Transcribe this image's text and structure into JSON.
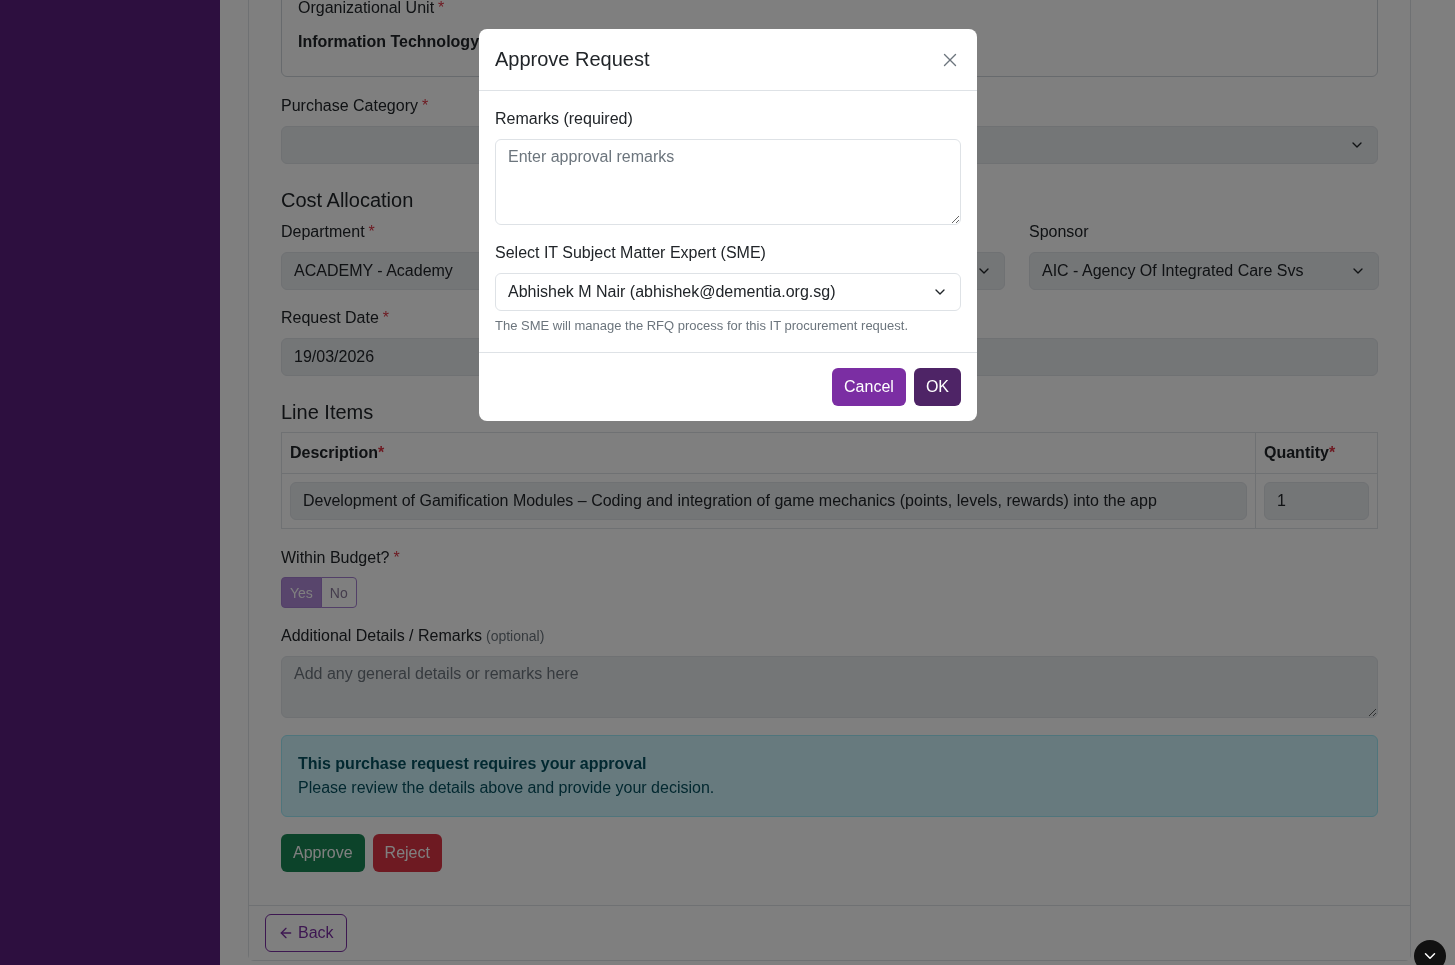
{
  "org_unit": {
    "label": "Organizational Unit",
    "required_mark": "*",
    "value": "Information Technology"
  },
  "purchase_category": {
    "label": "Purchase Category",
    "required_mark": "*"
  },
  "cost_allocation": {
    "title": "Cost Allocation",
    "fields": [
      {
        "kind": "select",
        "label": "Department",
        "required_mark": "*",
        "value": "ACADEMY - Academy"
      },
      {
        "kind": "select"
      },
      {
        "kind": "select",
        "label": "Sponsor",
        "value": "AIC - Agency Of Integrated Care Svs"
      }
    ]
  },
  "request_date": {
    "label": "Request Date",
    "required_mark": "*",
    "value": "19/03/2026"
  },
  "line_items": {
    "title": "Line Items",
    "columns": [
      {
        "label": "Description",
        "required_mark": "*"
      },
      {
        "label": "Quantity",
        "required_mark": "*"
      }
    ],
    "rows": [
      [
        "Development of Gamification Modules – Coding and integration of game mechanics (points, levels, rewards) into the app",
        "1"
      ]
    ]
  },
  "within_budget": {
    "label": "Within Budget?",
    "required_mark": "*",
    "options": [
      {
        "label": "Yes",
        "selected": true
      },
      {
        "label": "No",
        "selected": false
      }
    ]
  },
  "additional_details": {
    "label": "Additional Details / Remarks",
    "hint": "(optional)",
    "placeholder": "Add any general details or remarks here"
  },
  "alert": {
    "title": "This purchase request requires your approval",
    "text": "Please review the details above and provide your decision."
  },
  "actions": [
    {
      "label": "Approve",
      "kind": "success"
    },
    {
      "label": "Reject",
      "kind": "danger"
    }
  ],
  "back_button": {
    "label": "Back"
  },
  "modal": {
    "title": "Approve Request",
    "remarks": {
      "label": "Remarks (required)",
      "placeholder": "Enter approval remarks"
    },
    "sme": {
      "label": "Select IT Subject Matter Expert (SME)",
      "value": "Abhishek M Nair (abhishek@dementia.org.sg)",
      "help": "The SME will manage the RFQ process for this IT procurement request."
    },
    "buttons": [
      {
        "label": "Cancel",
        "kind": "secondary"
      },
      {
        "label": "OK",
        "kind": "primary"
      }
    ]
  }
}
